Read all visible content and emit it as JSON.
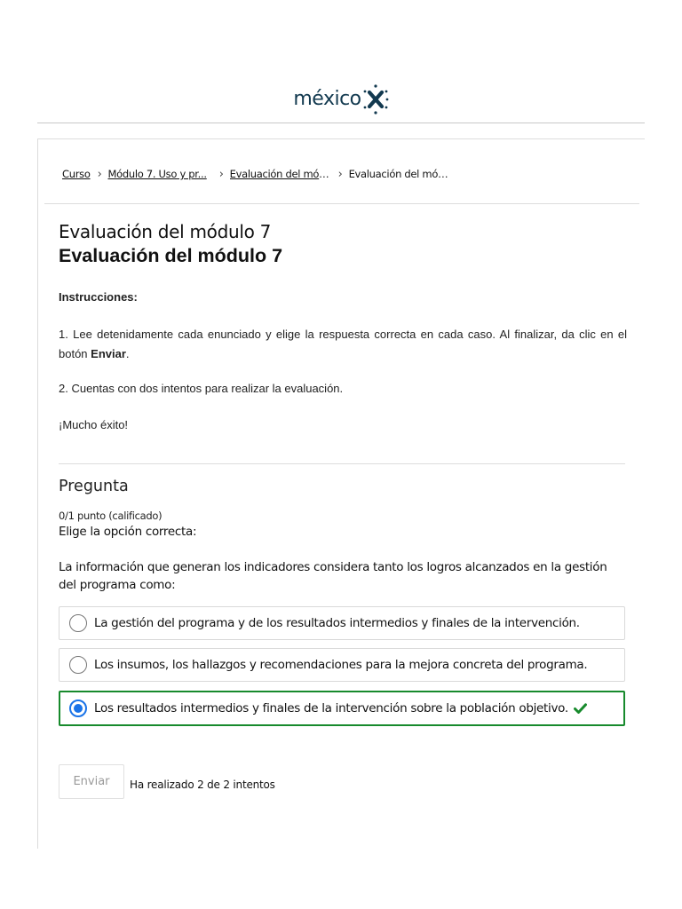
{
  "header": {
    "logo_text": "méxico",
    "logo_icon": "x-dots-logo-icon",
    "brand_color": "#12394f"
  },
  "breadcrumb": [
    {
      "label": "Curso"
    },
    {
      "label": "Módulo 7. Uso y pr..."
    },
    {
      "label": "Evaluación del mód..."
    },
    {
      "label": "Evaluación del mód..."
    }
  ],
  "page": {
    "title": "Evaluación del módulo 7",
    "subtitle": "Evaluación del módulo 7"
  },
  "instructions": {
    "heading": "Instrucciones:",
    "item1_text": "1. Lee detenidamente cada enunciado y elige la respuesta correcta en cada caso. Al finalizar, da clic en el botón ",
    "item1_bold": "Enviar",
    "item1_end": ".",
    "item2": "2. Cuentas con dos intentos para realizar la evaluación.",
    "closing": "¡Mucho éxito!"
  },
  "question": {
    "title": "Pregunta",
    "points": "0/1 punto (calificado)",
    "prompt": "Elige la opción correcta:",
    "stem": "La información que generan los indicadores considera tanto los logros alcanzados en la gestión del programa como:",
    "options": [
      {
        "label": "La gestión del programa y de los resultados intermedios y finales de la intervención.",
        "selected": false
      },
      {
        "label": "Los insumos, los hallazgos y recomendaciones para la mejora concreta del programa.",
        "selected": false
      },
      {
        "label": "Los resultados intermedios y finales de la intervención sobre la población objetivo.",
        "selected": true,
        "correct": true
      }
    ],
    "correct_color": "#178a2c",
    "radio_color": "#1a73e8"
  },
  "actions": {
    "submit_label": "Enviar",
    "attempts_text": "Ha realizado 2 de 2 intentos"
  }
}
